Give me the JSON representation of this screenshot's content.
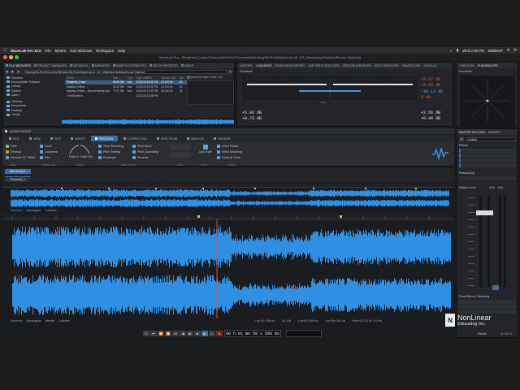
{
  "menu_bar": {
    "app_name": "WaveLab Pro 10.0",
    "items": [
      "File",
      "Meters",
      "Tool Windows",
      "Workspace",
      "Help"
    ],
    "clock": "Wed 2:30 PM",
    "user": "MattMVP"
  },
  "window": {
    "title": "WaveLab Pro - [Flustered_2.wav (/Volumes/WLPro/C/Courses/Steinberg/WLPro10/WaveLab-10_101_Mastering-Workflow/Source Material)]"
  },
  "file_browser": {
    "tabs": [
      "FILE BROWSER",
      "PROJECT MANAGER",
      "METADATA",
      "MARKERS",
      "SAMPLE ATTRIBUTES",
      "BATCH PROCESS",
      "TASKS"
    ],
    "active_tab": "FILE BROWSER",
    "path": "/Volumes/WLPro/C/Courses/Steinberg/WLPro10/WaveLab-10_101_Mastering-Workflow/Source Material/",
    "folders": [
      "Volumes",
      "Incompatible Software",
      "Library",
      "System",
      "Users"
    ],
    "folders2": [
      "Volumes",
      "Documents",
      "Desktop",
      "Library"
    ],
    "columns": [
      "Name",
      "Size",
      "Type",
      "Date Modified",
      "Sample Rate",
      "Bits",
      "Ch"
    ],
    "files": [
      {
        "name": "Flustered_2.wav",
        "size": "60.56 MB",
        "type": "wav",
        "date": "11/12/19 12:42 PM",
        "rate": "44 100 Hz",
        "bits": "24",
        "ch": "2",
        "selected": true
      },
      {
        "name": "Mayday Chillwe ...",
        "size": "60.12 MB",
        "type": "wav",
        "date": "11/12/19 12:41 PM",
        "rate": "44 100 Hz",
        "bits": "24",
        "ch": "2",
        "selected": false
      },
      {
        "name": "Mayday Chillwe ...Bus premaster.wav",
        "size": "77.67 MB",
        "type": "wav",
        "date": "11/12/19 12:40 PM",
        "rate": "44 100 Hz",
        "bits": "24",
        "ch": "2",
        "selected": false
      },
      {
        "name": "The Richelieu",
        "size": "",
        "type": "",
        "date": "11/12/19 12:38 PM",
        "rate": "",
        "bits": "",
        "ch": "",
        "selected": false
      }
    ],
    "preview_label": "[A] loosen 8x /spec  F.wav / .txt"
  },
  "meters": {
    "tabs": [
      "HISTORY",
      "LOUDNESS",
      "SOUNDNESS METER",
      "LIVE SPECTROSCOPE",
      "SPECTROGRAPHER",
      "SPECTROSCOPE",
      "WAVESCOPE",
      "OSCILLO"
    ],
    "active_tab": "LOUDNESS",
    "functions_label": "Functions",
    "peak_left": "-0.67 dB",
    "peak_right": "-0.68 dB",
    "rms_left": "-10.13 dB",
    "rms_right": "0 dB",
    "extra_left_1": "+5.06 dB",
    "extra_left_2": "+0.76 dB",
    "extra_right_1": "+2.56 dB",
    "extra_right_2": "+0.40 dB",
    "pan_label": "Pan",
    "colors": {
      "peak": "#ff4a3a",
      "neutral": "#e2e4e6",
      "accent": "#5aa2ff"
    }
  },
  "phasescope": {
    "tabs": [
      "TIMECODE",
      "PHASESCOPE"
    ],
    "functions_label": "Functions"
  },
  "audio_editor": {
    "header": "AUDIO EDITOR",
    "tabs": [
      {
        "label": "FILE",
        "active": false
      },
      {
        "label": "VIEW",
        "active": false
      },
      {
        "label": "EDIT",
        "active": false
      },
      {
        "label": "INSERT",
        "active": false
      },
      {
        "label": "PROCESS",
        "active": true
      },
      {
        "label": "CORRECTION",
        "active": false
      },
      {
        "label": "SPECTRUM",
        "active": false
      },
      {
        "label": "ANALYZE",
        "active": false
      },
      {
        "label": "RENDER",
        "active": false
      }
    ],
    "ribbon": {
      "gain": "Gain",
      "envelope": "Develop",
      "remove_dc": "Remove DC Offset",
      "level": "Level",
      "loudness": "Loudness",
      "pan": "Pan",
      "fade_in": "Fade In",
      "fade_out": "Fade Out",
      "time_stretching": "Time Stretching",
      "pitch_shifting": "Pitch Shifting",
      "resample": "Resample",
      "pitch_bend": "Pitch Bend",
      "pitch_quantizing": "Pitch Quantizing",
      "reverse": "Reverse",
      "invert_phase": "Invert Phase",
      "effect_morphing": "Effect Morphing",
      "external_tools": "External Tools",
      "auto_split": "Auto Split",
      "groups": [
        "LEVEL",
        "NORMALIZE",
        "FADES",
        "TIME & PITCH",
        "LOOP",
        "SPLIT",
        "OTHER"
      ]
    },
    "file_tab": "File Group 1",
    "sub_file_tab": "Flustered_2",
    "subtabs_overview": [
      "Waveform",
      "Spectrogram",
      "Loudness"
    ],
    "subtabs_main": [
      "Waveform",
      "Spectrogram",
      "Wavelet",
      "Loudness"
    ],
    "status": {
      "cursor": "1 mn 58 s 598 ms",
      "level": "-36.4 dB",
      "zoom": "1 mn 58 s 598 ms",
      "length": "2 mn 55 s 360 ms",
      "sample_rate": "Stereo 44 100 Hz / 24 bits"
    },
    "wave_color": "#2f8fe3",
    "cursor_color": "#e34a3b"
  },
  "transport": {
    "timecode": "00 h 01 mn 58 s 598 ms"
  },
  "master_section": {
    "tabs": [
      "MASTER SECTION",
      "RENDER"
    ],
    "preset": "Untitled",
    "effects_label": "Effects",
    "resampling_label": "Resampling",
    "master_level_label": "Master Level",
    "master_level_values": [
      "0.00",
      "0.00"
    ],
    "final_effects_label": "Final Effects / Dithering",
    "render_label": "Render",
    "sample_rate": "44 100 Hz"
  },
  "watermark": {
    "main": "NonLinear",
    "sub": "Educating Inc."
  }
}
